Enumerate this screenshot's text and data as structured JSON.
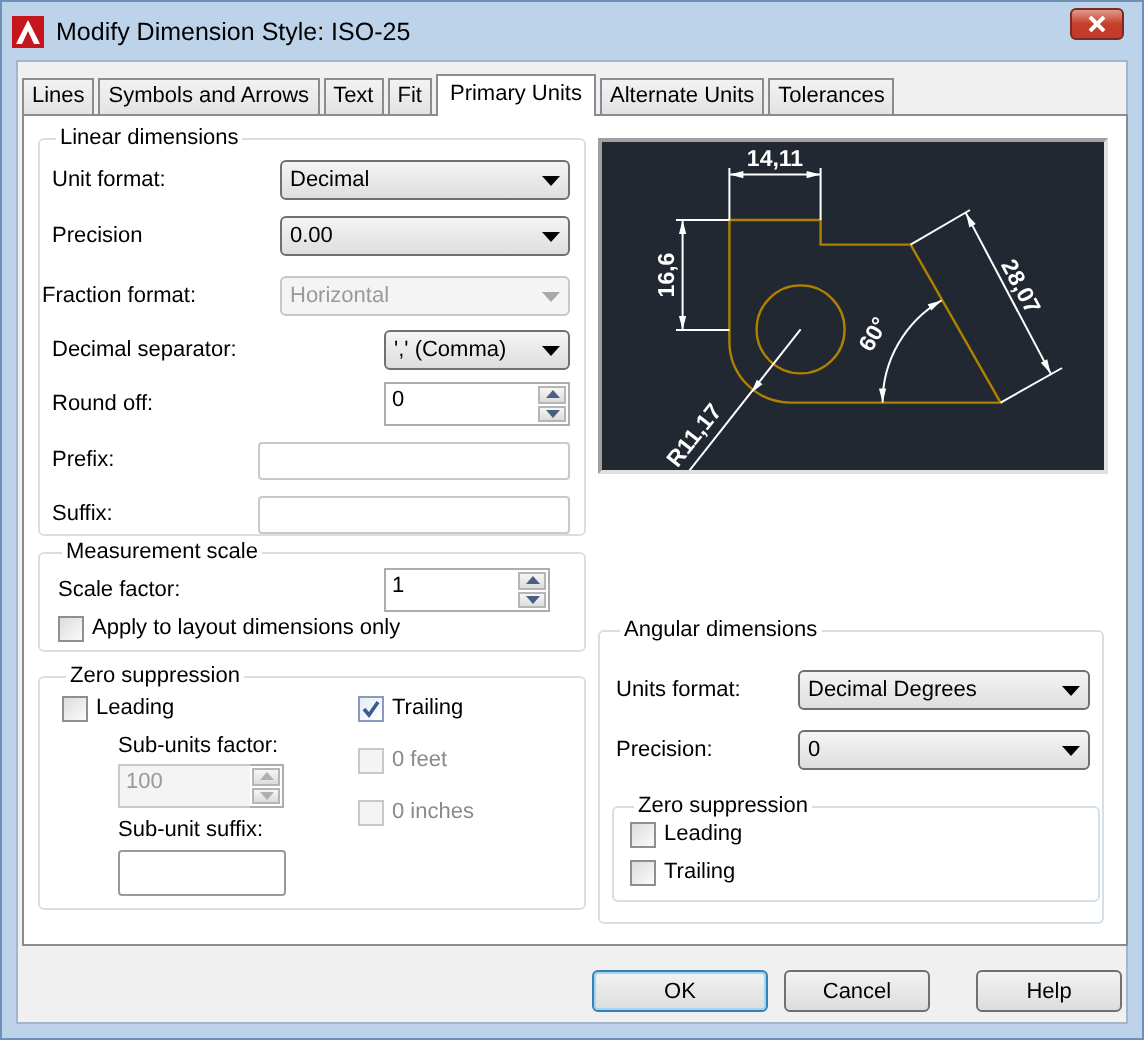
{
  "window": {
    "title": "Modify Dimension Style: ISO-25"
  },
  "tabs": [
    {
      "label": "Lines",
      "selected": false
    },
    {
      "label": "Symbols and Arrows",
      "selected": false
    },
    {
      "label": "Text",
      "selected": false
    },
    {
      "label": "Fit",
      "selected": false
    },
    {
      "label": "Primary Units",
      "selected": true
    },
    {
      "label": "Alternate Units",
      "selected": false
    },
    {
      "label": "Tolerances",
      "selected": false
    }
  ],
  "linear_dimensions": {
    "title": "Linear dimensions",
    "fields": [
      {
        "kind": "dropdown",
        "label": "Unit format:",
        "value": "Decimal",
        "disabled": false
      },
      {
        "kind": "dropdown",
        "label": "Precision",
        "value": "0.00",
        "disabled": false
      },
      {
        "kind": "dropdown",
        "label": "Fraction format:",
        "value": "Horizontal",
        "disabled": true
      },
      {
        "kind": "dropdown",
        "label": "Decimal separator:",
        "value": "',' (Comma)",
        "disabled": false
      },
      {
        "kind": "spinner",
        "label": "Round off:",
        "value": "0",
        "disabled": false
      },
      {
        "kind": "text",
        "label": "Prefix:",
        "disabled": false
      },
      {
        "kind": "text",
        "label": "Suffix:",
        "disabled": false
      }
    ]
  },
  "measurement_scale": {
    "title": "Measurement scale",
    "scale_factor": {
      "label": "Scale factor:",
      "value": "1"
    },
    "apply_to_layout": {
      "label": "Apply to layout dimensions only",
      "checked": false
    }
  },
  "zero_suppression": {
    "title": "Zero suppression",
    "leading": {
      "label": "Leading",
      "checked": false
    },
    "sub_units_factor": {
      "label": "Sub-units factor:",
      "value": "100",
      "disabled": true
    },
    "sub_unit_suffix": {
      "label": "Sub-unit suffix:"
    },
    "right_options": [
      {
        "label": "Trailing",
        "checked": true,
        "disabled": false
      },
      {
        "label": "0 feet",
        "checked": false,
        "disabled": true
      },
      {
        "label": "0 inches",
        "checked": false,
        "disabled": true
      }
    ]
  },
  "preview": {
    "dimension_labels": [
      "14,11",
      "16,6",
      "28,07",
      "60°",
      "R11,17"
    ]
  },
  "angular_dimensions": {
    "title": "Angular dimensions",
    "units_format": {
      "label": "Units format:",
      "value": "Decimal Degrees"
    },
    "precision": {
      "label": "Precision:",
      "value": "0"
    },
    "zero_suppression": {
      "title": "Zero suppression",
      "options": [
        {
          "label": "Leading",
          "checked": false
        },
        {
          "label": "Trailing",
          "checked": false
        }
      ]
    }
  },
  "buttons": [
    {
      "label": "OK",
      "default": true
    },
    {
      "label": "Cancel",
      "default": false
    },
    {
      "label": "Help",
      "default": false
    }
  ]
}
